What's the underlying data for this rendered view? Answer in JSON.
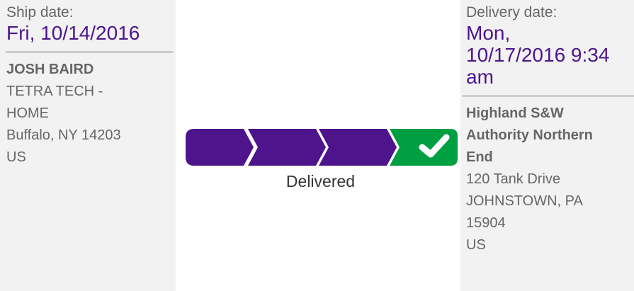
{
  "ship": {
    "label": "Ship date:",
    "date": "Fri, 10/14/2016",
    "name": "JOSH BAIRD",
    "lines": [
      "TETRA TECH -",
      "HOME",
      "Buffalo, NY 14203",
      "US"
    ]
  },
  "delivery": {
    "label": "Delivery date:",
    "date_lines": [
      "Mon,",
      "10/17/2016 9:34",
      "am"
    ],
    "name_lines": [
      "Highland S&W",
      "Authority Northern",
      "End"
    ],
    "lines": [
      "120 Tank Drive",
      "JOHNSTOWN, PA",
      "15904",
      "US"
    ]
  },
  "progress": {
    "status": "Delivered",
    "steps_completed": 4,
    "steps_total": 4,
    "colors": {
      "complete": "#4d148c",
      "delivered": "#00a042",
      "check": "#ffffff"
    },
    "icons": [
      "progress-step-icon",
      "progress-step-icon",
      "progress-step-icon",
      "delivered-check-icon"
    ]
  }
}
